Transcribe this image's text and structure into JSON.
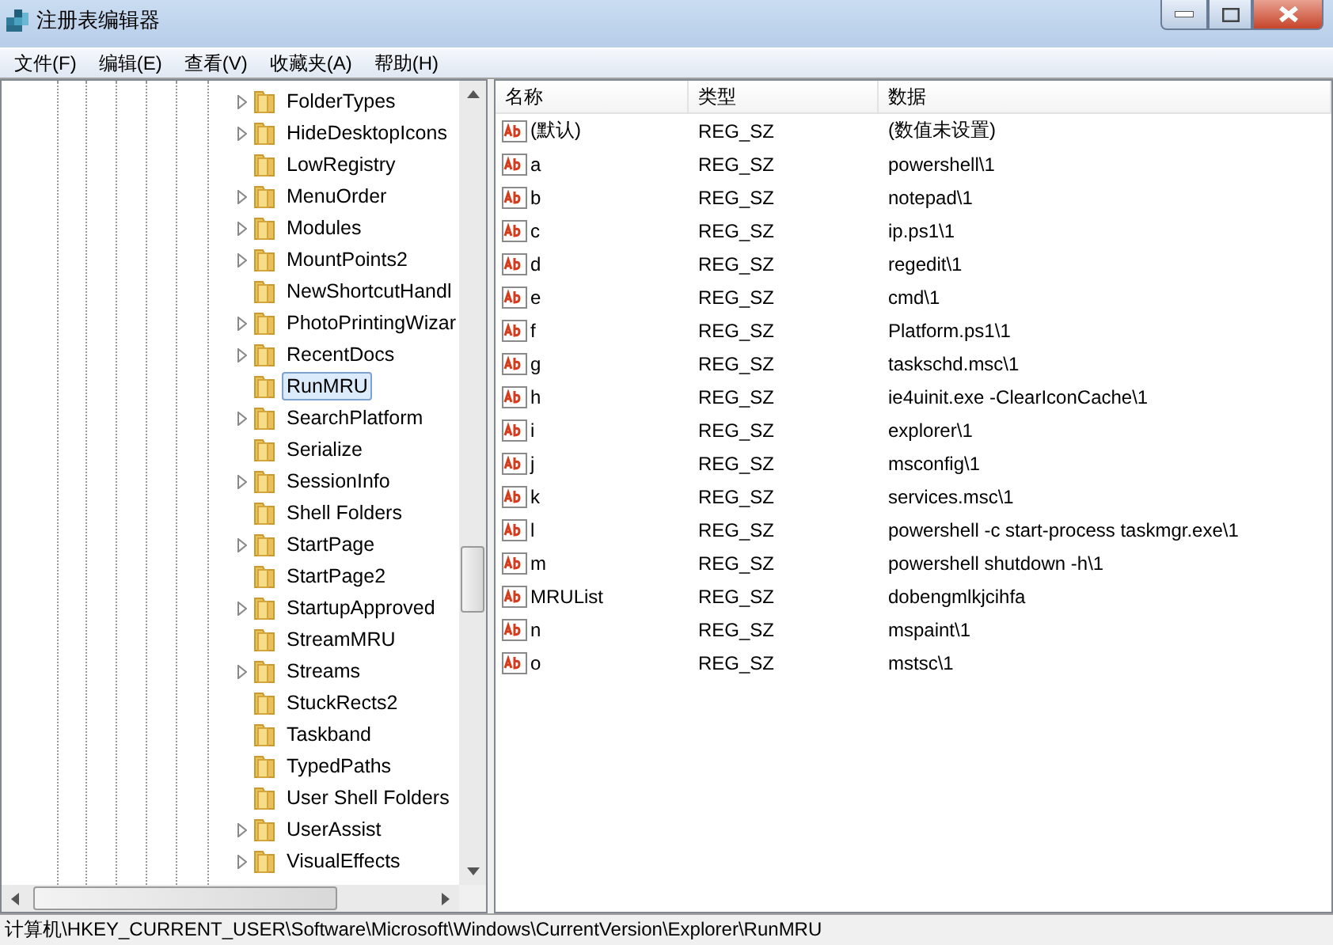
{
  "window": {
    "title": "注册表编辑器"
  },
  "menu": [
    "文件(F)",
    "编辑(E)",
    "查看(V)",
    "收藏夹(A)",
    "帮助(H)"
  ],
  "tree": [
    {
      "label": "FolderTypes",
      "expandable": true,
      "selected": false
    },
    {
      "label": "HideDesktopIcons",
      "expandable": true,
      "selected": false
    },
    {
      "label": "LowRegistry",
      "expandable": false,
      "selected": false
    },
    {
      "label": "MenuOrder",
      "expandable": true,
      "selected": false
    },
    {
      "label": "Modules",
      "expandable": true,
      "selected": false
    },
    {
      "label": "MountPoints2",
      "expandable": true,
      "selected": false
    },
    {
      "label": "NewShortcutHandl",
      "expandable": false,
      "selected": false
    },
    {
      "label": "PhotoPrintingWizar",
      "expandable": true,
      "selected": false
    },
    {
      "label": "RecentDocs",
      "expandable": true,
      "selected": false
    },
    {
      "label": "RunMRU",
      "expandable": false,
      "selected": true
    },
    {
      "label": "SearchPlatform",
      "expandable": true,
      "selected": false
    },
    {
      "label": "Serialize",
      "expandable": false,
      "selected": false
    },
    {
      "label": "SessionInfo",
      "expandable": true,
      "selected": false
    },
    {
      "label": "Shell Folders",
      "expandable": false,
      "selected": false
    },
    {
      "label": "StartPage",
      "expandable": true,
      "selected": false
    },
    {
      "label": "StartPage2",
      "expandable": false,
      "selected": false
    },
    {
      "label": "StartupApproved",
      "expandable": true,
      "selected": false
    },
    {
      "label": "StreamMRU",
      "expandable": false,
      "selected": false
    },
    {
      "label": "Streams",
      "expandable": true,
      "selected": false
    },
    {
      "label": "StuckRects2",
      "expandable": false,
      "selected": false
    },
    {
      "label": "Taskband",
      "expandable": false,
      "selected": false
    },
    {
      "label": "TypedPaths",
      "expandable": false,
      "selected": false
    },
    {
      "label": "User Shell Folders",
      "expandable": false,
      "selected": false
    },
    {
      "label": "UserAssist",
      "expandable": true,
      "selected": false
    },
    {
      "label": "VisualEffects",
      "expandable": true,
      "selected": false
    }
  ],
  "table": {
    "columns": [
      "名称",
      "类型",
      "数据"
    ],
    "rows": [
      [
        "(默认)",
        "REG_SZ",
        "(数值未设置)"
      ],
      [
        "a",
        "REG_SZ",
        "powershell\\1"
      ],
      [
        "b",
        "REG_SZ",
        "notepad\\1"
      ],
      [
        "c",
        "REG_SZ",
        "ip.ps1\\1"
      ],
      [
        "d",
        "REG_SZ",
        "regedit\\1"
      ],
      [
        "e",
        "REG_SZ",
        "cmd\\1"
      ],
      [
        "f",
        "REG_SZ",
        "Platform.ps1\\1"
      ],
      [
        "g",
        "REG_SZ",
        "taskschd.msc\\1"
      ],
      [
        "h",
        "REG_SZ",
        "ie4uinit.exe -ClearIconCache\\1"
      ],
      [
        "i",
        "REG_SZ",
        "explorer\\1"
      ],
      [
        "j",
        "REG_SZ",
        "msconfig\\1"
      ],
      [
        "k",
        "REG_SZ",
        "services.msc\\1"
      ],
      [
        "l",
        "REG_SZ",
        "powershell -c start-process taskmgr.exe\\1"
      ],
      [
        "m",
        "REG_SZ",
        "powershell shutdown -h\\1"
      ],
      [
        "MRUList",
        "REG_SZ",
        "dobengmlkjcihfa"
      ],
      [
        "n",
        "REG_SZ",
        "mspaint\\1"
      ],
      [
        "o",
        "REG_SZ",
        "mstsc\\1"
      ]
    ]
  },
  "status_bar": "计算机\\HKEY_CURRENT_USER\\Software\\Microsoft\\Windows\\CurrentVersion\\Explorer\\RunMRU"
}
